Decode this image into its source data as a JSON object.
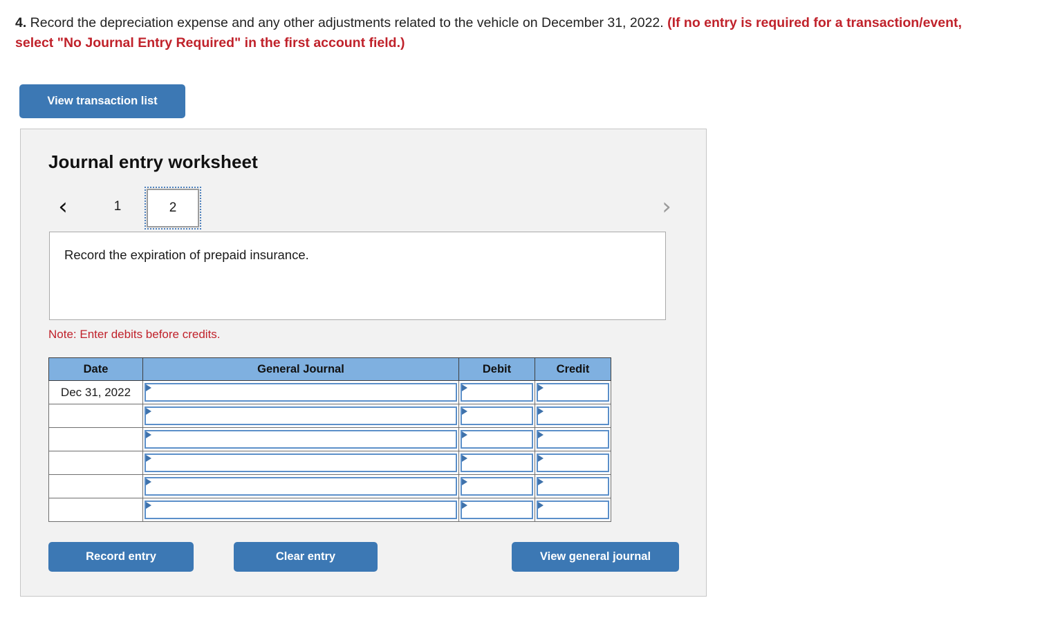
{
  "question": {
    "number": "4.",
    "text": " Record the depreciation expense and any other adjustments related to the vehicle on December 31, 2022. ",
    "instruction": "(If no entry is required for a transaction/event, select \"No Journal Entry Required\" in the first account field.)"
  },
  "toolbar": {
    "view_transaction_list_label": "View transaction list"
  },
  "worksheet": {
    "title": "Journal entry worksheet",
    "pager": {
      "prev_icon": "chevron-left-icon",
      "prev_glyph": "‹",
      "next_icon": "chevron-right-icon",
      "next_glyph": "›",
      "pages": [
        "1",
        "2"
      ],
      "active_page": "2"
    },
    "description": "Record the expiration of prepaid insurance.",
    "note": "Note: Enter debits before credits.",
    "table": {
      "columns": [
        "Date",
        "General Journal",
        "Debit",
        "Credit"
      ],
      "rows": [
        {
          "date": "Dec 31, 2022",
          "general_journal": "",
          "debit": "",
          "credit": ""
        },
        {
          "date": "",
          "general_journal": "",
          "debit": "",
          "credit": ""
        },
        {
          "date": "",
          "general_journal": "",
          "debit": "",
          "credit": ""
        },
        {
          "date": "",
          "general_journal": "",
          "debit": "",
          "credit": ""
        },
        {
          "date": "",
          "general_journal": "",
          "debit": "",
          "credit": ""
        },
        {
          "date": "",
          "general_journal": "",
          "debit": "",
          "credit": ""
        }
      ]
    },
    "actions": {
      "record_entry_label": "Record entry",
      "clear_entry_label": "Clear entry",
      "view_general_journal_label": "View general journal"
    }
  },
  "colors": {
    "button_blue": "#3c78b4",
    "table_header_blue": "#7fb0e0",
    "note_red": "#c0222b",
    "panel_gray": "#f2f2f2",
    "input_border_blue": "#5b8fc9"
  }
}
